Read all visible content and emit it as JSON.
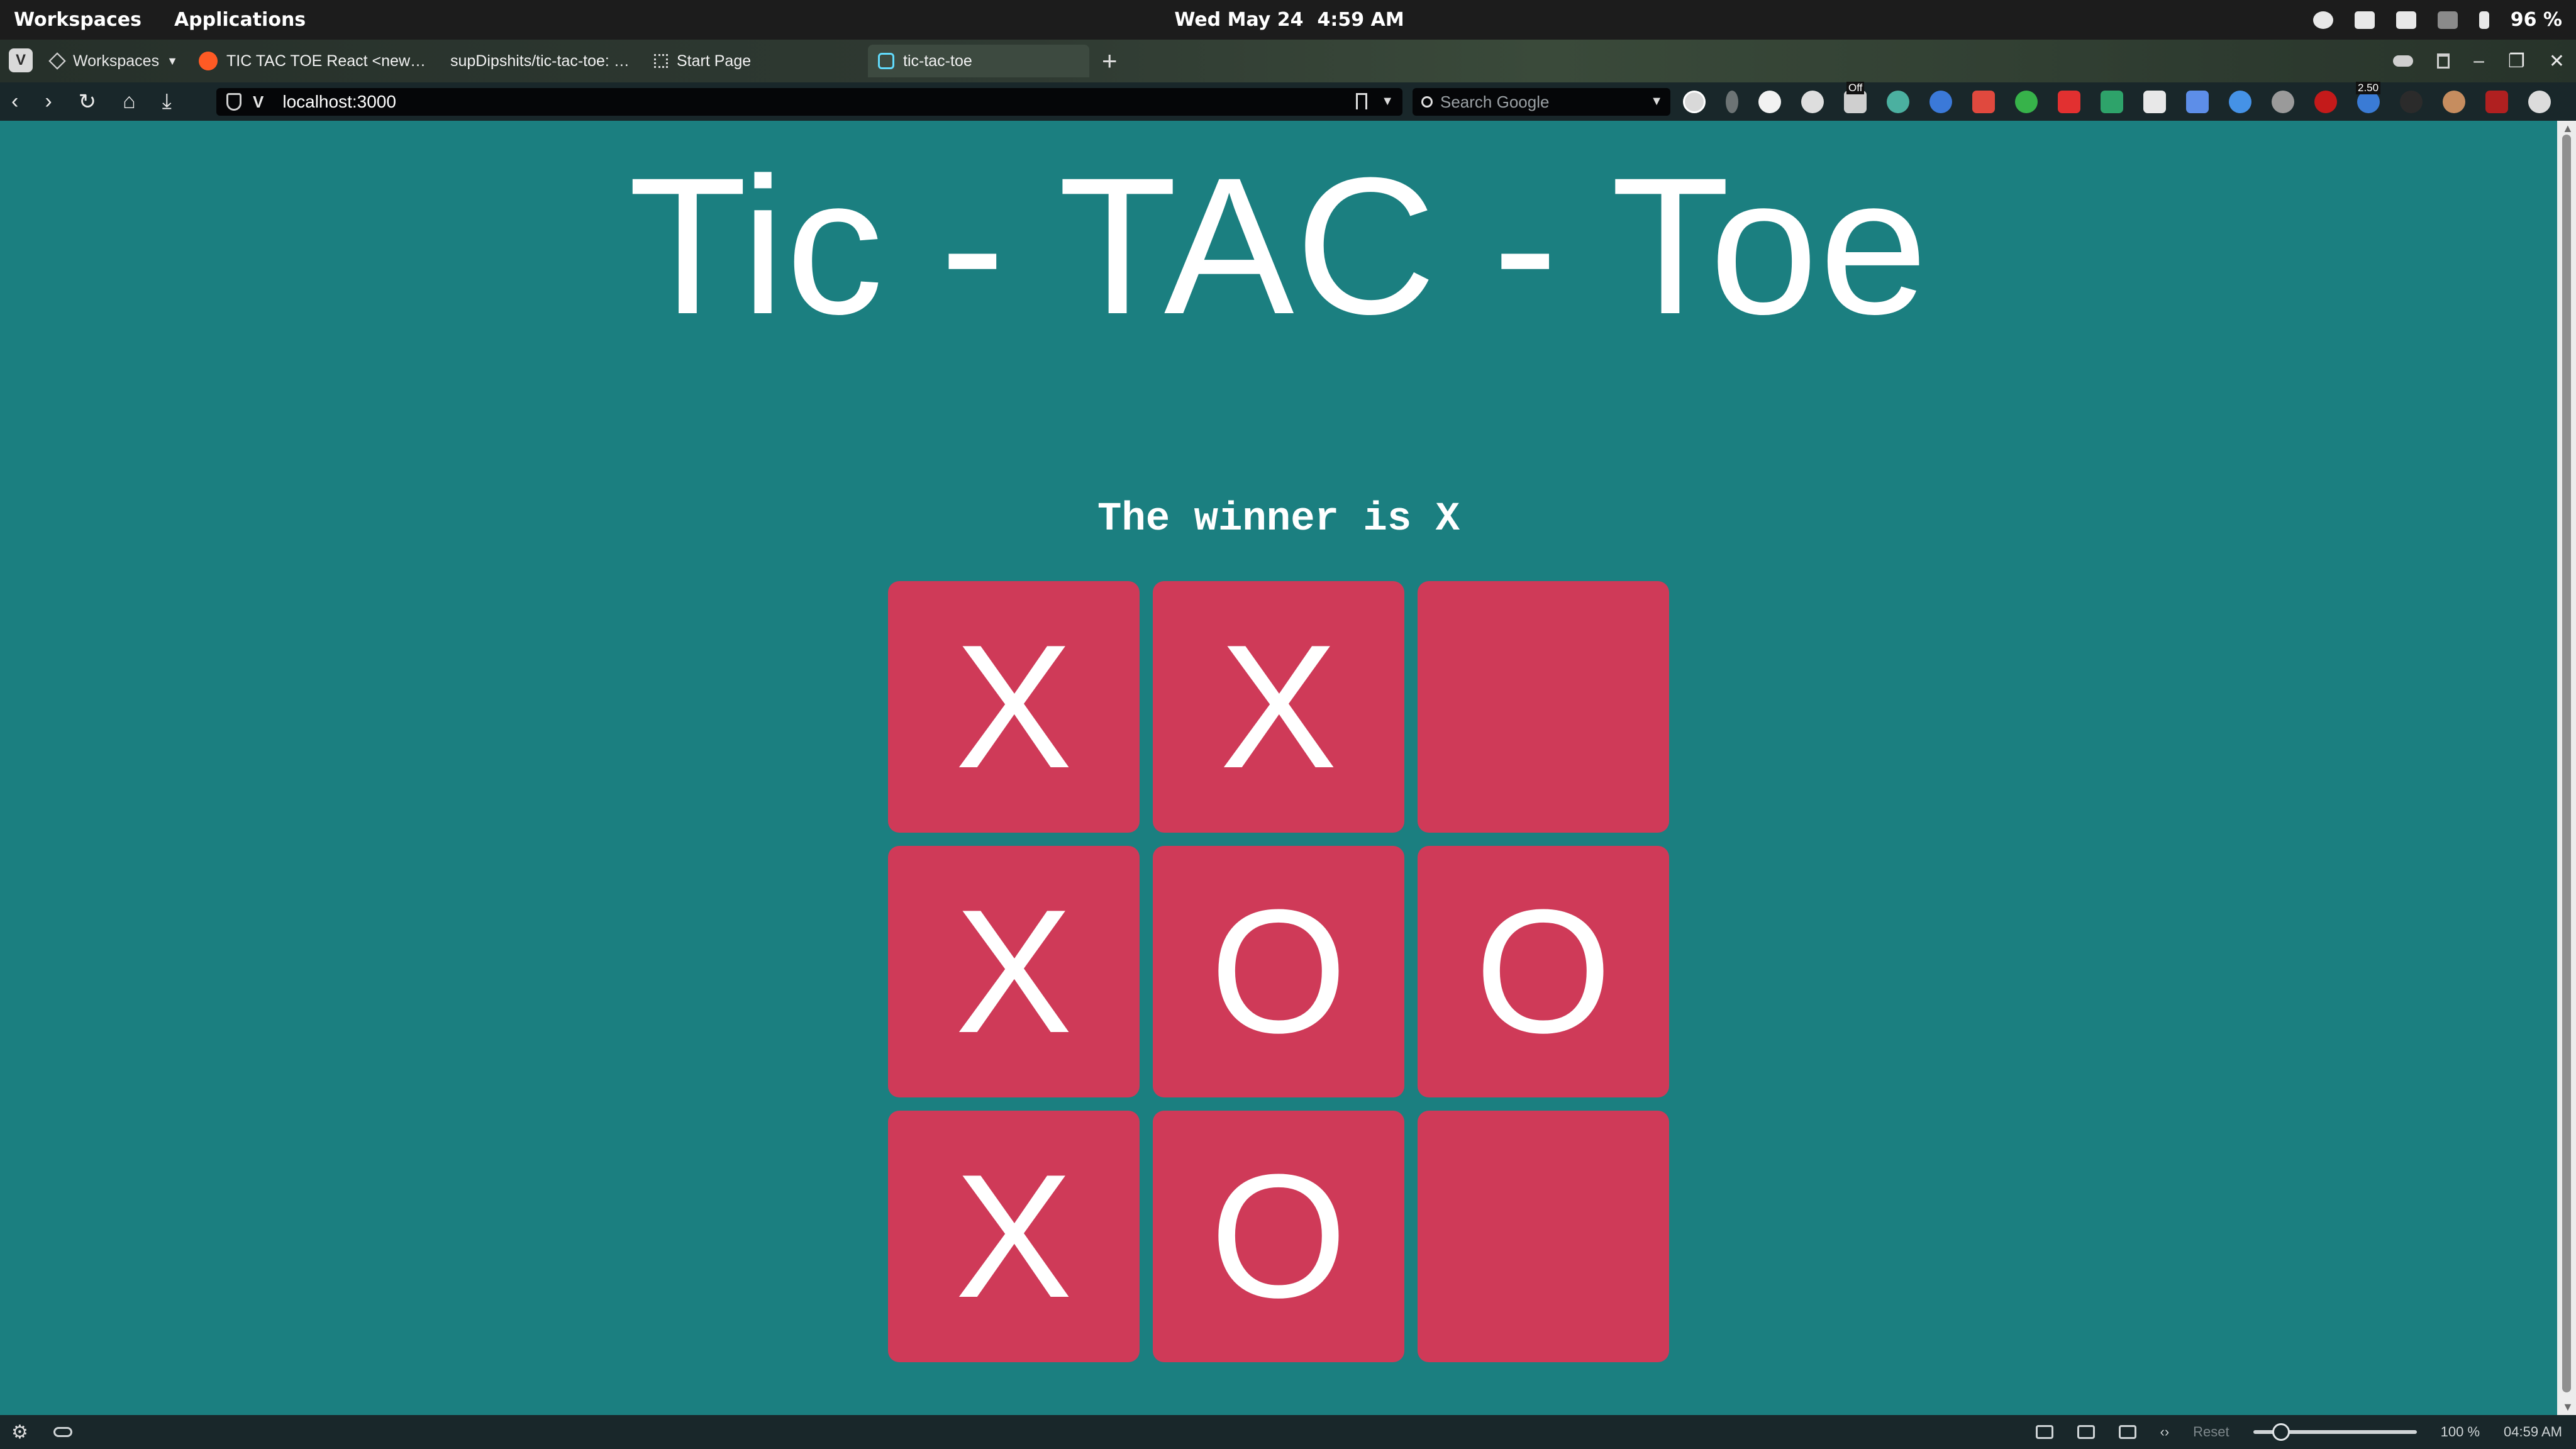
{
  "topbar": {
    "workspaces": "Workspaces",
    "applications": "Applications",
    "date": "Wed May 24",
    "time": "4:59 AM",
    "battery": "96 %"
  },
  "browser": {
    "workspaces_label": "Workspaces",
    "tabs": [
      {
        "title": "TIC TAC TOE React <new…",
        "icon": "reddit-icon",
        "color": "#ff5a24"
      },
      {
        "title": "supDipshits/tic-tac-toe: …",
        "icon": "github-icon",
        "color": "#2e3a33"
      },
      {
        "title": "Start Page",
        "icon": "grid-icon",
        "color": "#cfcfcf"
      },
      {
        "title": "tic-tac-toe",
        "icon": "react-icon",
        "color": "#61dafb"
      }
    ],
    "url": "localhost:3000",
    "search_placeholder": "Search Google"
  },
  "extensions": {
    "badge_off": "Off",
    "badge_count": "2.50"
  },
  "page": {
    "title": "Tic - TAC - Toe",
    "status": "The winner is X",
    "board": [
      "X",
      "X",
      "",
      "X",
      "O",
      "O",
      "X",
      "O",
      ""
    ]
  },
  "statusbar": {
    "reset": "Reset",
    "zoom": "100 %",
    "time": "04:59 AM"
  },
  "colors": {
    "page_bg": "#1b7f80",
    "cell_bg": "#cf3a58",
    "text": "#ffffff"
  }
}
